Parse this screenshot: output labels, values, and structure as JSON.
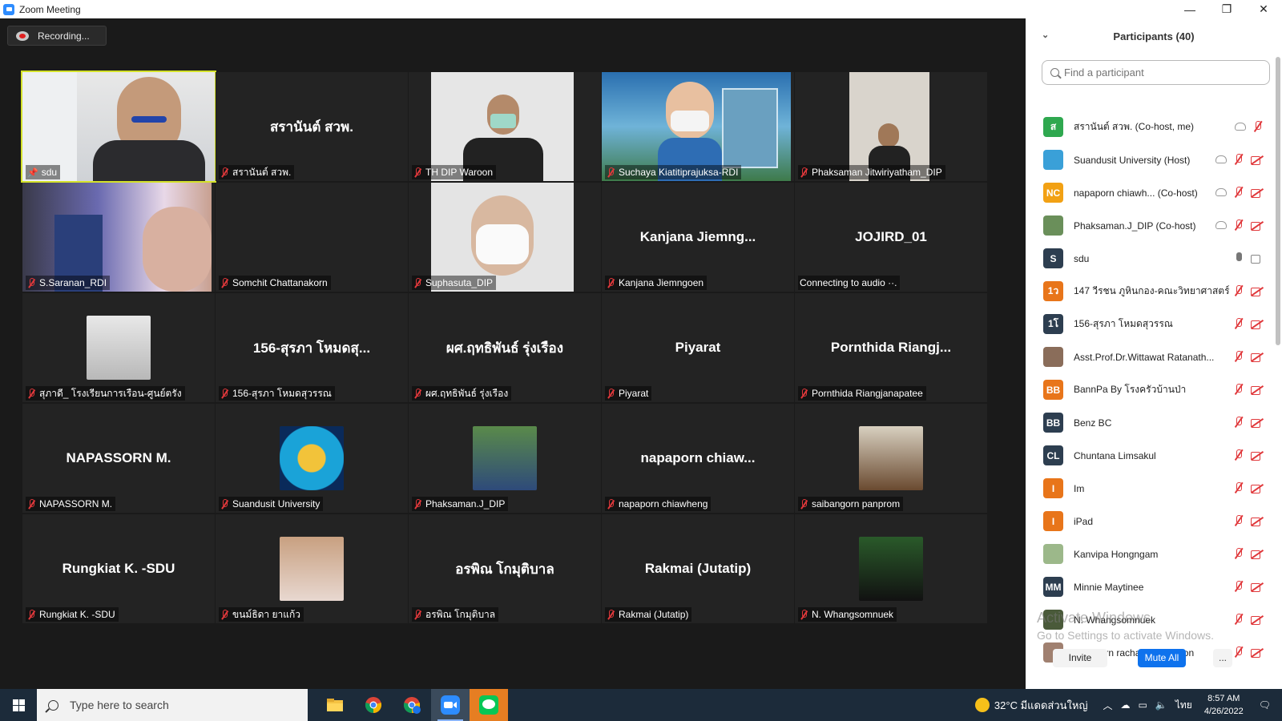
{
  "window": {
    "title": "Zoom Meeting",
    "minimize": "—",
    "restore": "❐",
    "close": "✕"
  },
  "recording": {
    "label": "Recording..."
  },
  "tiles": [
    {
      "caption": "sdu",
      "pinned": true
    },
    {
      "bigname": "สรานันต์ สวพ.",
      "caption": "สรานันต์ สวพ."
    },
    {
      "caption": "TH DIP Waroon"
    },
    {
      "caption": "Suchaya Kiatitiprajuksa-RDI"
    },
    {
      "caption": "Phaksaman Jitwiriyatham_DIP"
    },
    {
      "caption": "S.Saranan_RDI"
    },
    {
      "caption": "Somchit Chattanakorn"
    },
    {
      "caption": "Suphasuta_DIP"
    },
    {
      "bigname": "Kanjana  Jiemng...",
      "caption": "Kanjana Jiemngoen"
    },
    {
      "bigname": "JOJIRD_01",
      "caption": "Connecting to audio ··."
    },
    {
      "caption": "สุภาดี_ โรงเรียนการเรือน-ศูนย์ตรัง"
    },
    {
      "bigname": "156-สุรภา โหมดสุ...",
      "caption": "156-สุรภา โหมดสุวรรณ"
    },
    {
      "bigname": "ผศ.ฤทธิพันธ์ รุ่งเรือง",
      "caption": "ผศ.ฤทธิพันธ์ รุ่งเรือง"
    },
    {
      "bigname": "Piyarat",
      "caption": "Piyarat"
    },
    {
      "bigname": "Pornthida  Riangj...",
      "caption": "Pornthida Riangjanapatee"
    },
    {
      "bigname": "NAPASSORN M.",
      "caption": "NAPASSORN M."
    },
    {
      "caption": "Suandusit University"
    },
    {
      "caption": "Phaksaman.J_DIP"
    },
    {
      "bigname": "napaporn  chiaw...",
      "caption": "napaporn chiawheng"
    },
    {
      "caption": "saibangorn panprom"
    },
    {
      "bigname": "Rungkiat K. -SDU",
      "caption": "Rungkiat K. -SDU"
    },
    {
      "caption": "ขนม์ธิดา ยาแก้ว"
    },
    {
      "bigname": "อรพิณ โกมุติบาล",
      "caption": "อรพิณ โกมุติบาล"
    },
    {
      "bigname": "Rakmai (Jutatip)",
      "caption": "Rakmai (Jutatip)"
    },
    {
      "caption": "N. Whangsomnuek"
    }
  ],
  "participants": {
    "title": "Participants (40)",
    "search_placeholder": "Find a participant",
    "list": [
      {
        "initials": "ส",
        "name": "สรานันต์ สวพ. (Co-host, me)",
        "color": "#2fa84f"
      },
      {
        "initials": "",
        "name": "Suandusit University (Host)",
        "color": "#3aa0d8"
      },
      {
        "initials": "NC",
        "name": "napaporn chiawh... (Co-host)",
        "color": "#f2a114"
      },
      {
        "initials": "",
        "name": "Phaksaman.J_DIP (Co-host)",
        "color": "#6a8f5a"
      },
      {
        "initials": "S",
        "name": "sdu",
        "color": "#2d3e50"
      },
      {
        "initials": "1ว",
        "name": "147 วีรชน ภูหินกอง-คณะวิทยาศาสตร์",
        "color": "#e8751a"
      },
      {
        "initials": "1โ",
        "name": "156-สุรภา โหมดสุวรรณ",
        "color": "#2d3e50"
      },
      {
        "initials": "",
        "name": "Asst.Prof.Dr.Wittawat Ratanath...",
        "color": "#8a6d5a"
      },
      {
        "initials": "BB",
        "name": "BannPa By โรงครัวบ้านป่า",
        "color": "#e8751a"
      },
      {
        "initials": "BB",
        "name": "Benz BC",
        "color": "#2d3e50"
      },
      {
        "initials": "CL",
        "name": "Chuntana Limsakul",
        "color": "#2d3e50"
      },
      {
        "initials": "I",
        "name": "Im",
        "color": "#e8751a"
      },
      {
        "initials": "I",
        "name": "iPad",
        "color": "#e8751a"
      },
      {
        "initials": "",
        "name": "Kanvipa Hongngam",
        "color": "#9cb88a"
      },
      {
        "initials": "MM",
        "name": "Minnie Maytinee",
        "color": "#2d3e50"
      },
      {
        "initials": "",
        "name": "N. Whangsomnuek",
        "color": "#4a5a3a"
      },
      {
        "initials": "",
        "name": "napasorn rachatapeemapon",
        "color": "#a08070"
      }
    ],
    "invite": "Invite",
    "mute_all": "Mute All",
    "more": "..."
  },
  "watermark": {
    "line1": "Activate Windows",
    "line2": "Go to Settings to activate Windows."
  },
  "taskbar": {
    "search_placeholder": "Type here to search",
    "weather": "32°C  มีแดดส่วนใหญ่",
    "lang": "ไทย",
    "time": "8:57 AM",
    "date": "4/26/2022"
  }
}
